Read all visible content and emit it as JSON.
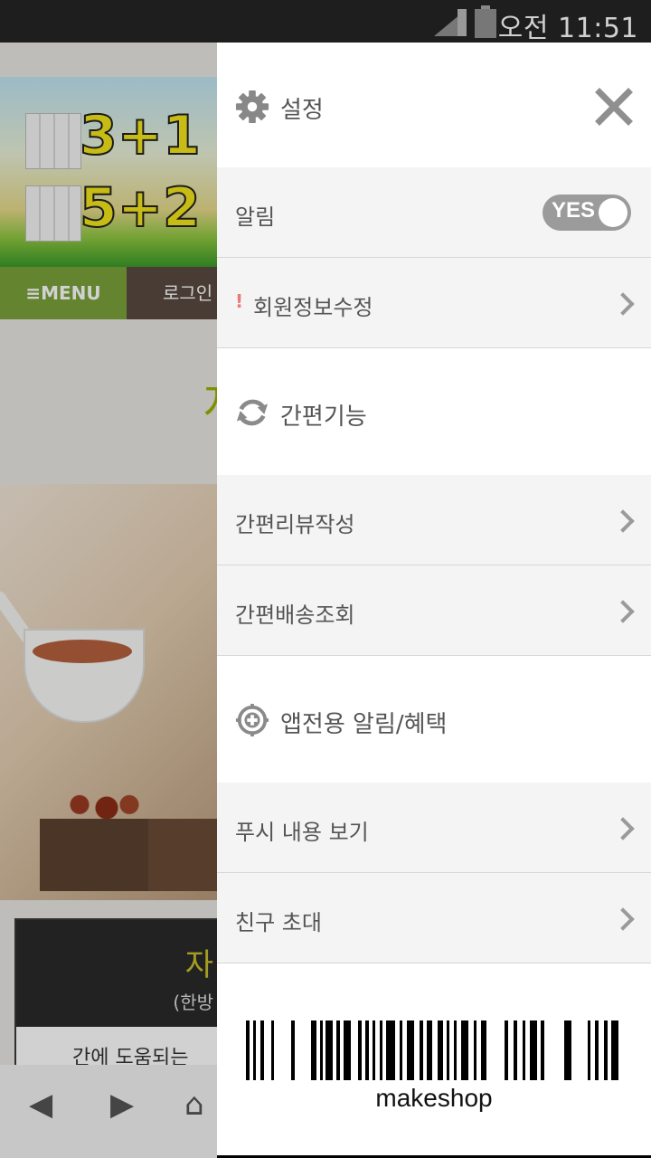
{
  "status_bar": {
    "time": "오전 11:51",
    "signal_icon": "signal-icon",
    "battery_icon": "battery-icon"
  },
  "background_app": {
    "promo_1": "3+1",
    "promo_2": "5+2",
    "menu_label": "≡MENU",
    "login_label": "로그인",
    "section_heading": "자",
    "product_title": "자",
    "product_subtitle": "(한방",
    "product_desc": "간에 도움되는"
  },
  "settings_panel": {
    "header": {
      "title": "설정",
      "gear_icon": "gear-icon",
      "close_icon": "close-icon"
    },
    "notification": {
      "label": "알림",
      "toggle_label": "YES",
      "toggle_on": true
    },
    "member_edit": {
      "marker": "!",
      "label": "회원정보수정"
    },
    "shortcut_section": {
      "title": "간편기능",
      "icon": "refresh-icon"
    },
    "shortcut_items": [
      {
        "label": "간편리뷰작성"
      },
      {
        "label": "간편배송조회"
      }
    ],
    "app_section": {
      "title": "앱전용 알림/혜택",
      "icon": "target-plus-icon"
    },
    "app_items": [
      {
        "label": "푸시 내용 보기"
      },
      {
        "label": "친구 초대"
      }
    ],
    "barcode": {
      "text": "makeshop"
    }
  }
}
